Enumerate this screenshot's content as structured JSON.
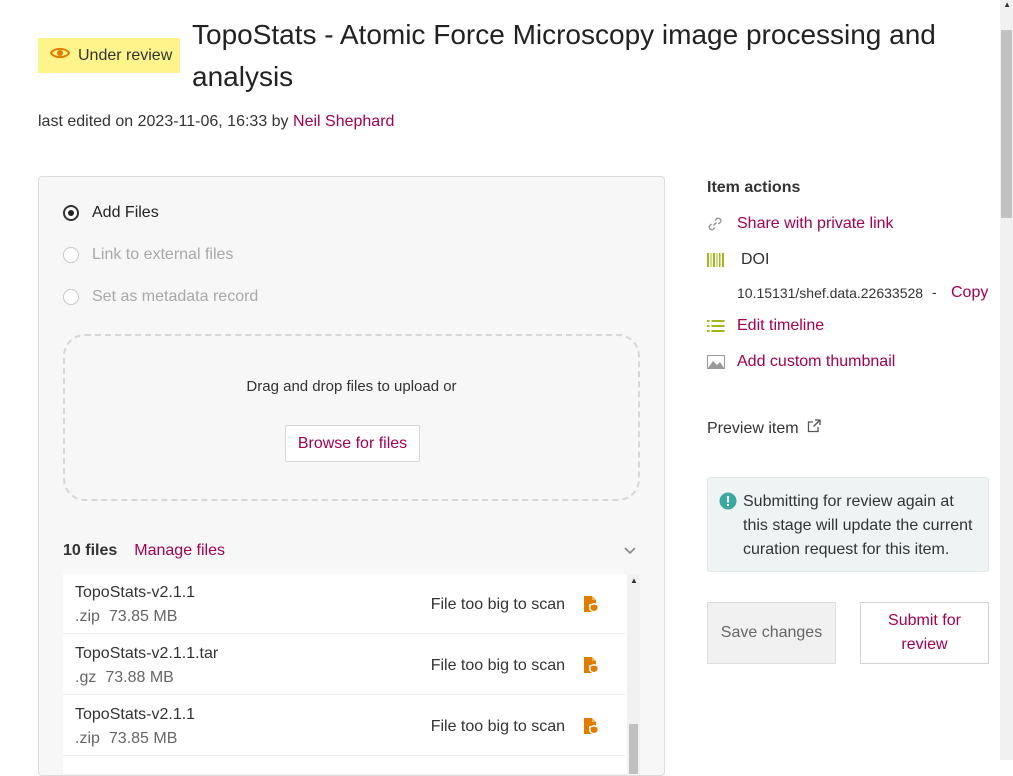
{
  "header": {
    "status": "Under review",
    "title": "TopoStats - Atomic Force Microscopy image processing and analysis",
    "edited_prefix": "last edited on 2023-11-06, 16:33 by",
    "editor": "Neil Shephard"
  },
  "upload": {
    "options": [
      {
        "label": "Add Files",
        "selected": true,
        "disabled": false
      },
      {
        "label": "Link to external files",
        "selected": false,
        "disabled": true
      },
      {
        "label": "Set as metadata record",
        "selected": false,
        "disabled": true
      }
    ],
    "dropzone_text": "Drag and drop files to upload or",
    "browse_label": "Browse for files"
  },
  "files": {
    "count_label": "10 files",
    "manage_label": "Manage files",
    "items": [
      {
        "name": "TopoStats-v2.1.1",
        "ext": ".zip",
        "size": "73.85 MB",
        "status": "File too big to scan"
      },
      {
        "name": "TopoStats-v2.1.1.tar",
        "ext": ".gz",
        "size": "73.88 MB",
        "status": "File too big to scan"
      },
      {
        "name": "TopoStats-v2.1.1",
        "ext": ".zip",
        "size": "73.85 MB",
        "status": "File too big to scan"
      }
    ]
  },
  "item_actions": {
    "heading": "Item actions",
    "share_label": "Share with private link",
    "doi_label": "DOI",
    "doi_value": "10.15131/shef.data.22633528",
    "doi_separator": "-",
    "copy_label": "Copy",
    "timeline_label": "Edit timeline",
    "thumbnail_label": "Add custom thumbnail",
    "preview_label": "Preview item"
  },
  "notice": {
    "text": "Submitting for review again at this stage will update the current curation request for this item."
  },
  "buttons": {
    "save": "Save changes",
    "submit": "Submit for review"
  },
  "colors": {
    "accent": "#a40050",
    "badge": "#fdf58c",
    "icon_orange": "#e07c00",
    "icon_green": "#a3b51a",
    "notice_bg": "#eef4f4",
    "info_teal": "#3aa7a0"
  }
}
